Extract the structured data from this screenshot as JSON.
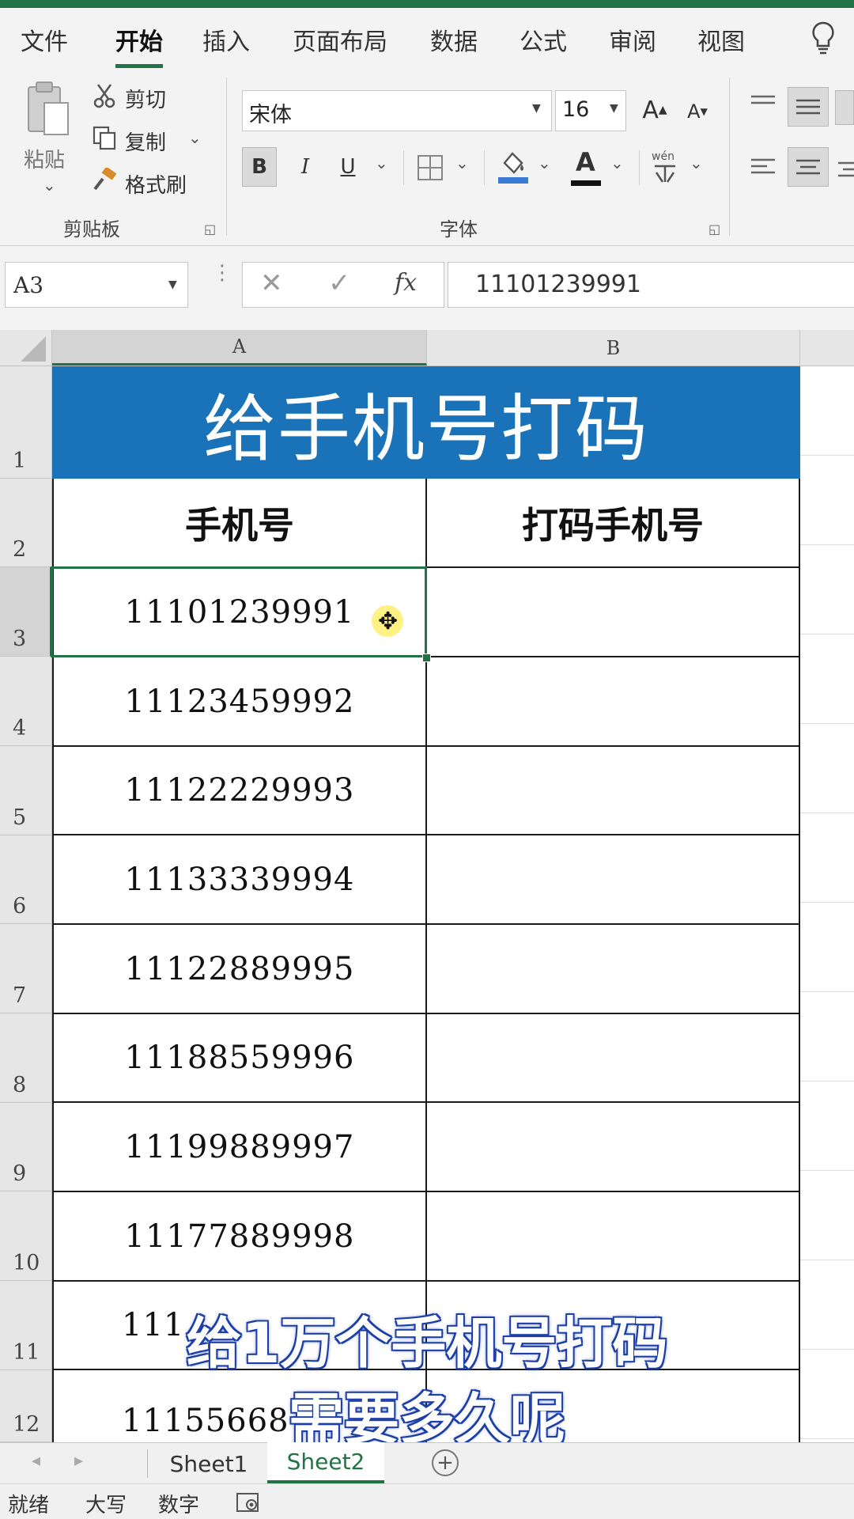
{
  "ribbon_tabs": [
    "文件",
    "开始",
    "插入",
    "页面布局",
    "数据",
    "公式",
    "审阅",
    "视图"
  ],
  "active_tab": "开始",
  "clipboard": {
    "paste": "粘贴",
    "cut": "剪切",
    "copy": "复制",
    "format_painter": "格式刷",
    "group_label": "剪贴板"
  },
  "font_group": {
    "font_name": "宋体",
    "font_size": "16",
    "bold": "B",
    "italic": "I",
    "underline": "U",
    "font_color_glyph": "A",
    "grow_font": "A",
    "shrink_font": "A",
    "phonetic": "wén",
    "group_label": "字体"
  },
  "formula_bar": {
    "name_box": "A3",
    "fx": "fx",
    "value": "11101239991"
  },
  "columns": [
    "A",
    "B"
  ],
  "rows": [
    "1",
    "2",
    "3",
    "4",
    "5",
    "6",
    "7",
    "8",
    "9",
    "10",
    "11",
    "12"
  ],
  "sheet": {
    "title": "给手机号打码",
    "header_a": "手机号",
    "header_b": "打码手机号",
    "phones": [
      "11101239991",
      "11123459992",
      "11122229993",
      "11133339994",
      "11122889995",
      "11188559996",
      "11199889997",
      "11177889998",
      "111",
      "11155668"
    ]
  },
  "sheet_tabs": [
    "Sheet1",
    "Sheet2"
  ],
  "active_sheet": "Sheet2",
  "status": [
    "就绪",
    "大写",
    "数字"
  ],
  "caption": {
    "line1": "给1万个手机号打码",
    "line2": "需要多久呢"
  },
  "colors": {
    "excel_green": "#217346",
    "title_fill": "#1a73b8",
    "caption_outline": "#1d3fa8"
  }
}
